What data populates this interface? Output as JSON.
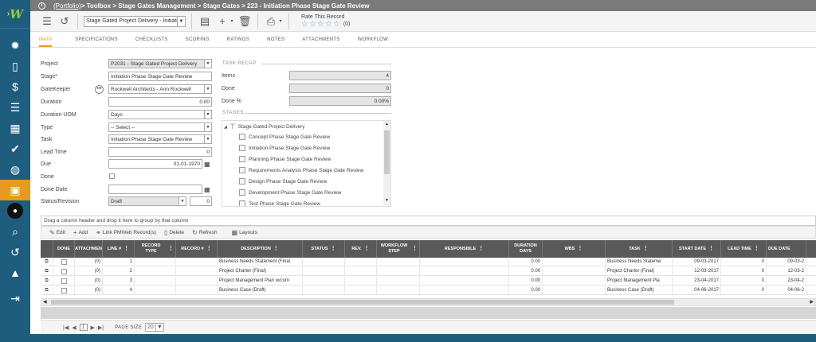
{
  "topbar": {
    "info_icon": "i",
    "portfolio": "(Portfolio)",
    "breadcrumb": " > Toolbox > Stage Gates Management > Stage Gates > 223 - Initiation Phase Stage Gate Review"
  },
  "toolbar": {
    "record_select": "Stage Gated Project Delivery - Initiati",
    "rate_label": "Rate This Record",
    "stars": "☆☆☆☆☆",
    "rating_count": "(0)"
  },
  "tabs": [
    "MAIN",
    "SPECIFICATIONS",
    "CHECKLISTS",
    "SCORING",
    "RATINGS",
    "NOTES",
    "ATTACHMENTS",
    "WORKFLOW"
  ],
  "form": {
    "project_label": "Project",
    "project_value": "P2031 - Stage Gated Project Delivery",
    "stage_label": "Stage*",
    "stage_value": "Initiation Phase Stage Gate Review",
    "gatekeeper_label": "GateKeeper",
    "gatekeeper_value": "Rockwell Architects - Ann Rockwell",
    "duration_label": "Duration",
    "duration_value": "0.00",
    "duration_uom_label": "Duration UOM",
    "duration_uom_value": "Days",
    "type_label": "Type",
    "type_value": "-- Select --",
    "task_label": "Task",
    "task_value": "Initiation Phase Stage Gate Review",
    "lead_time_label": "Lead Time",
    "lead_time_value": "0",
    "due_label": "Due",
    "due_value": "01-01-1970",
    "done_label": "Done",
    "done_date_label": "Done Date",
    "done_date_value": "",
    "status_label": "Status/Revision",
    "status_value": "Draft",
    "revision_value": "0"
  },
  "recap": {
    "title": "TASK RECAP",
    "items_label": "Items",
    "items_value": "4",
    "done_label": "Done",
    "done_value": "0",
    "done_pct_label": "Done %",
    "done_pct_value": "0.00%",
    "stages_title": "STAGES",
    "root": "Stage Gated Project Delivery",
    "stages": [
      "Concept Phase Stage Gate Review",
      "Initiation Phase Stage Gate Review",
      "Planning Phase Stage Gate Review",
      "Requirements Analysis Phase Stage Gate Review",
      "Design Phase Stage Gate Review",
      "Development Phase Stage Gate Review",
      "Test Phase Stage Gate Review"
    ]
  },
  "grid": {
    "group_hint": "Drag a column header and drop it here to group by that column",
    "toolbar": {
      "edit": "Edit",
      "add": "Add",
      "link": "Link PMWeb Record(s)",
      "delete": "Delete",
      "refresh": "Refresh",
      "layouts": "Layouts"
    },
    "headers": {
      "done": "DONE",
      "attach": "ATTACHMEN",
      "line": "LINE #",
      "record_type": "RECORD TYPE",
      "record_no": "RECORD #",
      "description": "DESCRIPTION",
      "status": "STATUS",
      "rev": "REV.",
      "wf_step": "WORKFLOW STEP",
      "responsible": "RESPONSIBLE",
      "dur_days": "DURATION DAYS",
      "wbs": "WBS",
      "task": "TASK",
      "start_date": "START DATE",
      "lead_time": "LEAD TIME",
      "due_date": "DUE DATE"
    },
    "rows": [
      {
        "attach": "(0)",
        "line": "1",
        "description": "Business Needs Statement (Final",
        "duration": "0.00",
        "task": "Business Needs Stateme",
        "start": "09-03-2017",
        "lead": "0",
        "due": "09-03-2"
      },
      {
        "attach": "(0)",
        "line": "2",
        "description": "Project Charter (Final)",
        "duration": "0.00",
        "task": "Project Charter (Final)",
        "start": "12-03-2017",
        "lead": "0",
        "due": "12-03-2"
      },
      {
        "attach": "(0)",
        "line": "3",
        "description": "Project Management Plan w/com",
        "duration": "0.00",
        "task": "Project Management Pla",
        "start": "23-04-2017",
        "lead": "0",
        "due": "23-04-2"
      },
      {
        "attach": "(0)",
        "line": "4",
        "description": "Business Case (Draft)",
        "duration": "0.00",
        "task": "Business Case (Draft)",
        "start": "04-06-2017",
        "lead": "0",
        "due": "04-06-2"
      }
    ],
    "pager": {
      "current_page": "1",
      "page_size_label": "PAGE SIZE",
      "page_size": "20"
    }
  },
  "colors": {
    "sidebar": "#1e5d7e",
    "accent": "#e69a1e",
    "grid_header": "#595959"
  }
}
